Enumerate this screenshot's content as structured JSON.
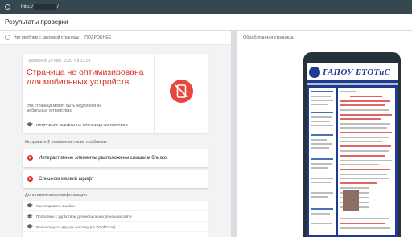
{
  "topbar": {
    "url_prefix": "http://",
    "url_suffix": "/"
  },
  "header": {
    "title": "Результаты проверки"
  },
  "status": {
    "text": "Нет проблем с загрузкой страницы",
    "details_label": "ПОДРОБНЕЕ"
  },
  "result": {
    "date": "Проверено 29 июн. 2020 г. в 17:24",
    "verdict": "Страница не оптимизирована для мобильных устройств",
    "description": "Эта страница может быть неудобной на мобильных устройствах",
    "fix_link": "ИСПРАВЬТЕ ОШИБКИ НА СТРАНИЦЕ WORDPRESS"
  },
  "issues": {
    "heading": "Исправьте 2 указанные ниже проблемы",
    "items": [
      "Интерактивные элементы расположены слишком близко",
      "Слишком мелкий шрифт"
    ]
  },
  "info": {
    "heading": "Дополнительная информация",
    "items": [
      "Как исправить ошибки",
      "Проблемы с удобством для мобильных (в нашем сайте",
      "В используете другую систему (не WordPress)"
    ]
  },
  "preview": {
    "label": "Обработанная страница",
    "site_title": "ГАПОУ БТОТиС"
  },
  "colors": {
    "error": "#d93025",
    "topbar": "#37474f",
    "site_blue": "#1f3a93"
  }
}
